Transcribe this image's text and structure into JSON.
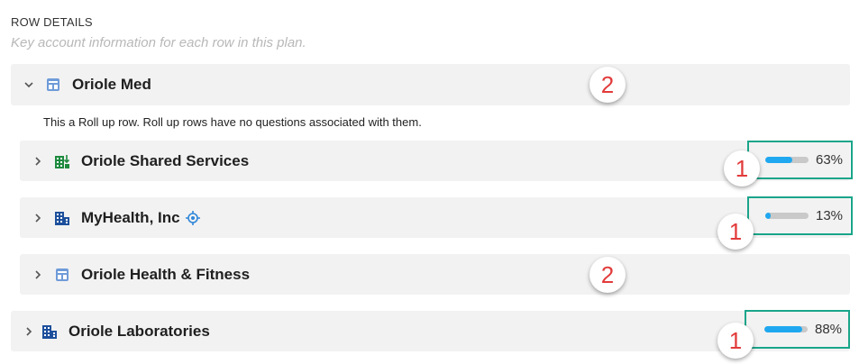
{
  "section": {
    "title": "ROW DETAILS",
    "subtitle": "Key account information for each row in this plan."
  },
  "rollup_note": "This a Roll up row. Roll up rows have no questions associated with them.",
  "colors": {
    "row_bg": "#f2f2f2",
    "progress_border": "#1aa58a",
    "bar_fill": "#1fa8f0",
    "badge_text": "#e23b3b"
  },
  "rows": [
    {
      "label": "Oriole Med",
      "icon": "table-icon",
      "expanded": true,
      "badge": "2"
    },
    {
      "label": "Oriole Shared Services",
      "icon": "building-download-icon",
      "expanded": false,
      "progress": 0.63,
      "progress_label": "63%",
      "badge": "1"
    },
    {
      "label": "MyHealth, Inc",
      "icon": "building-icon",
      "extra_icon": "target-icon",
      "expanded": false,
      "progress": 0.13,
      "progress_label": "13%",
      "badge": "1"
    },
    {
      "label": "Oriole Health & Fitness",
      "icon": "table-icon",
      "expanded": false,
      "badge": "2"
    },
    {
      "label": "Oriole Laboratories",
      "icon": "building-icon",
      "expanded": false,
      "progress": 0.88,
      "progress_label": "88%",
      "badge": "1"
    }
  ]
}
